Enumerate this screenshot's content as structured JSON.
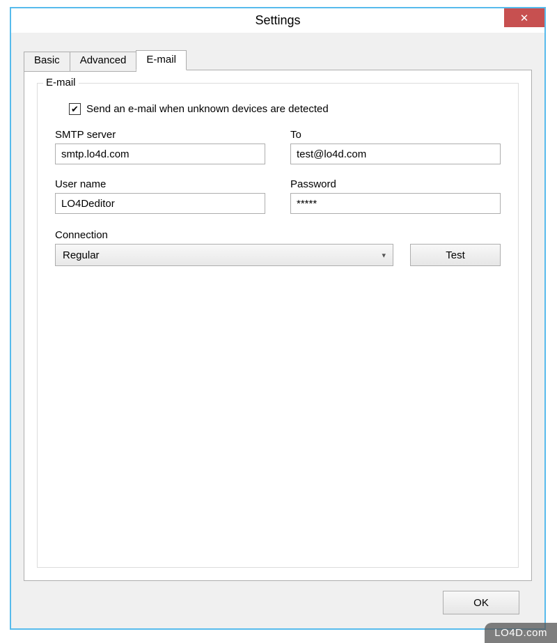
{
  "window": {
    "title": "Settings",
    "close_icon": "✕"
  },
  "tabs": {
    "basic": "Basic",
    "advanced": "Advanced",
    "email": "E-mail"
  },
  "groupbox": {
    "legend": "E-mail"
  },
  "checkbox": {
    "checked": true,
    "mark": "✔",
    "label": "Send an e-mail when unknown devices are detected"
  },
  "fields": {
    "smtp": {
      "label": "SMTP server",
      "value": "smtp.lo4d.com"
    },
    "to": {
      "label": "To",
      "value": "test@lo4d.com"
    },
    "username": {
      "label": "User name",
      "value": "LO4Deditor"
    },
    "password": {
      "label": "Password",
      "value": "*****"
    },
    "connection": {
      "label": "Connection",
      "value": "Regular"
    }
  },
  "buttons": {
    "test": "Test",
    "ok": "OK"
  },
  "dropdown_arrow": "▾",
  "watermark": "LO4D.com"
}
